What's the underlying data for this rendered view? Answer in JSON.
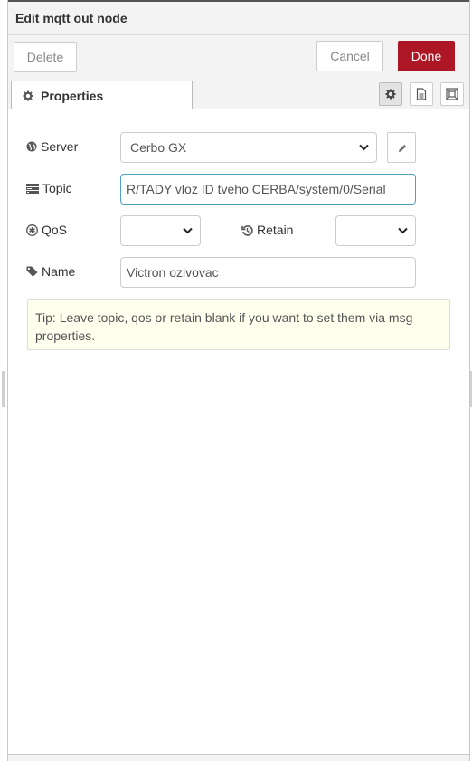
{
  "tray": {
    "title": "Edit mqtt out node"
  },
  "toolbar": {
    "delete_label": "Delete",
    "cancel_label": "Cancel",
    "done_label": "Done",
    "done_color": "#ad1625"
  },
  "tabs": [
    {
      "label": "Properties",
      "icon": "gear-icon",
      "active": true
    }
  ],
  "tab_buttons": [
    {
      "icon": "gear-icon",
      "selected": true
    },
    {
      "icon": "document-icon",
      "selected": false
    },
    {
      "icon": "frame-icon",
      "selected": false
    }
  ],
  "form": {
    "server": {
      "label": "Server",
      "icon": "globe-icon",
      "value": "Cerbo GX"
    },
    "topic": {
      "label": "Topic",
      "icon": "tasks-icon",
      "value": "R/TADY vloz ID tveho CERBA/system/0/Serial"
    },
    "qos": {
      "label": "QoS",
      "icon": "asterisk-icon",
      "value": ""
    },
    "retain": {
      "label": "Retain",
      "icon": "history-icon",
      "value": ""
    },
    "name": {
      "label": "Name",
      "icon": "tag-icon",
      "value": "Victron ozivovac"
    }
  },
  "tip": {
    "text": "Tip: Leave topic, qos or retain blank if you want to set them via msg properties."
  }
}
